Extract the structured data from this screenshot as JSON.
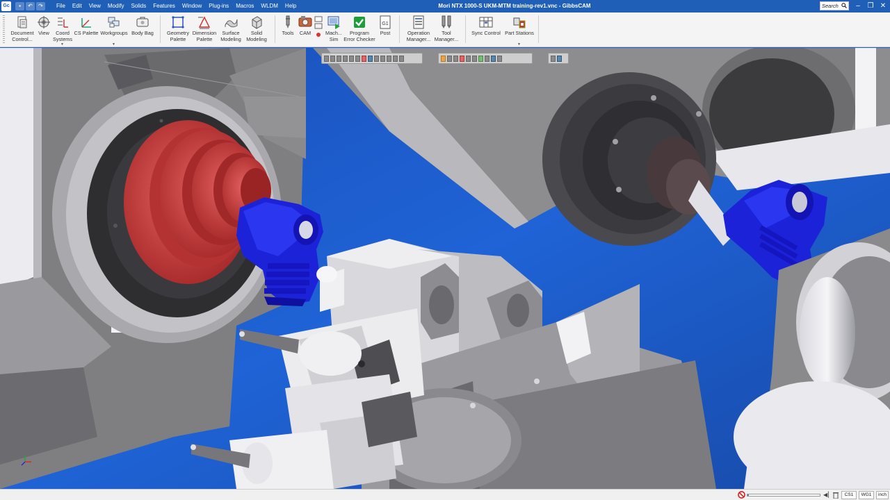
{
  "app": {
    "logo_text": "Gc",
    "window_title": "Mori NTX 1000-S UKM-MTM training-rev1.vnc - GibbsCAM"
  },
  "quick_access": [
    "save-icon",
    "undo-icon",
    "redo-icon"
  ],
  "menu": [
    "File",
    "Edit",
    "View",
    "Modify",
    "Solids",
    "Features",
    "Window",
    "Plug-ins",
    "Macros",
    "WLDM",
    "Help"
  ],
  "search": {
    "placeholder": "Search"
  },
  "window_controls": {
    "minimize": "–",
    "restore": "❐",
    "close": "✕"
  },
  "ribbon": {
    "document_control": "Document\nControl...",
    "view": "View",
    "coord_systems": "Coord\nSystems",
    "cs_palette": "CS Palette",
    "workgroups": "Workgroups",
    "body_bag": "Body Bag",
    "geometry_palette": "Geometry\nPalette",
    "dimension_palette": "Dimension\nPalette",
    "surface_modeling": "Surface\nModeling",
    "solid_modeling": "Solid\nModeling",
    "tools": "Tools",
    "cam": "CAM",
    "mach_sim": "Mach...\nSim",
    "program_error_checker": "Program\nError Checker",
    "post": "Post",
    "post_icon_text": "G1",
    "operation_manager": "Operation\nManager...",
    "tool_manager": "Tool\nManager...",
    "sync_control": "Sync Control",
    "part_stations": "Part Stations"
  },
  "status": {
    "progress_fraction": 0.02,
    "field_1": "CS1",
    "field_2": "WG1",
    "field_3": "inch"
  },
  "colors": {
    "titlebar": "#1f5fb8",
    "viewport_background": "#1e5fd0",
    "workpiece": "#1a1adf",
    "chuck": "#c83a3a",
    "machine_gray": "#8c8c8e"
  }
}
